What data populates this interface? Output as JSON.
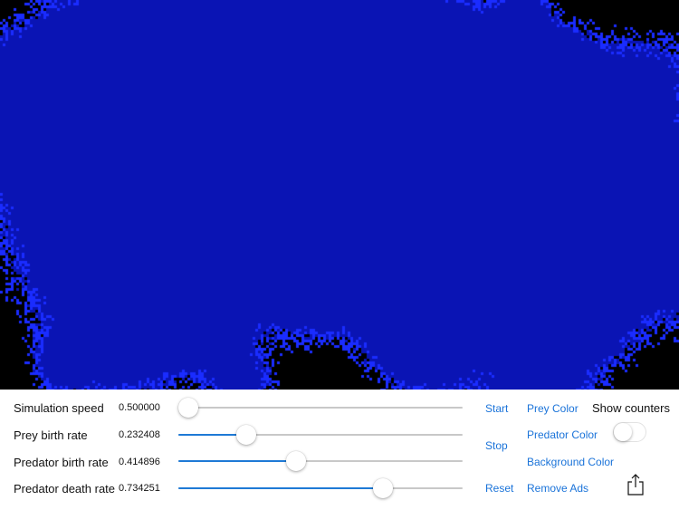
{
  "simulation": {
    "background_color": "#000000",
    "prey_color": "#0a14b4",
    "predator_color": "#1a2cff"
  },
  "controls": {
    "sliders": [
      {
        "label": "Simulation speed",
        "value_text": "0.500000",
        "fraction": 0.0
      },
      {
        "label": "Prey birth rate",
        "value_text": "0.232408",
        "fraction": 0.24
      },
      {
        "label": "Predator birth rate",
        "value_text": "0.414896",
        "fraction": 0.415
      },
      {
        "label": "Predator death rate",
        "value_text": "0.734251",
        "fraction": 0.72
      }
    ],
    "buttons": {
      "start": "Start",
      "stop": "Stop",
      "reset": "Reset",
      "prey_color": "Prey Color",
      "predator_color": "Predator Color",
      "background_color": "Background Color",
      "remove_ads": "Remove Ads"
    },
    "show_counters": {
      "label": "Show counters",
      "on": false
    },
    "accent_color": "#1a73d9"
  }
}
